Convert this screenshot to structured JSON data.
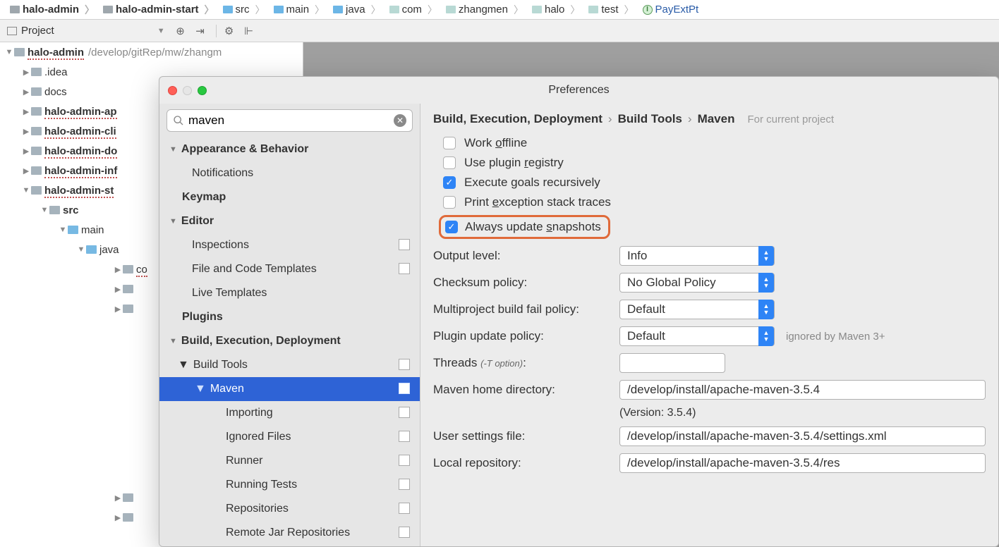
{
  "breadcrumb": [
    {
      "label": "halo-admin",
      "bold": true,
      "icon": "mod"
    },
    {
      "label": "halo-admin-start",
      "bold": true,
      "icon": "mod"
    },
    {
      "label": "src",
      "icon": "blue"
    },
    {
      "label": "main",
      "icon": "blue"
    },
    {
      "label": "java",
      "icon": "blue"
    },
    {
      "label": "com",
      "icon": "teal"
    },
    {
      "label": "zhangmen",
      "icon": "teal"
    },
    {
      "label": "halo",
      "icon": "teal"
    },
    {
      "label": "test",
      "icon": "teal"
    },
    {
      "label": "PayExtPt",
      "icon": "iface"
    }
  ],
  "project_label": "Project",
  "tree": {
    "root": {
      "name": "halo-admin",
      "path": "/develop/gitRep/mw/zhangm"
    },
    "children": [
      {
        "name": ".idea",
        "indent": 1,
        "arrow": "right",
        "bold": false
      },
      {
        "name": "docs",
        "indent": 1,
        "arrow": "right",
        "bold": false
      },
      {
        "name": "halo-admin-ap",
        "indent": 1,
        "arrow": "right",
        "bold": true,
        "squiggly": true
      },
      {
        "name": "halo-admin-cli",
        "indent": 1,
        "arrow": "right",
        "bold": true,
        "squiggly": true
      },
      {
        "name": "halo-admin-do",
        "indent": 1,
        "arrow": "right",
        "bold": true,
        "squiggly": true
      },
      {
        "name": "halo-admin-inf",
        "indent": 1,
        "arrow": "right",
        "bold": true,
        "squiggly": true
      },
      {
        "name": "halo-admin-st",
        "indent": 1,
        "arrow": "down",
        "bold": true,
        "squiggly": true
      },
      {
        "name": "src",
        "indent": 2,
        "arrow": "down",
        "bold": true,
        "blue": false
      },
      {
        "name": "main",
        "indent": 3,
        "arrow": "down",
        "bold": false,
        "blue": true
      },
      {
        "name": "java",
        "indent": 4,
        "arrow": "down",
        "bold": false,
        "blue": true
      },
      {
        "name": "co",
        "indent": 5,
        "arrow": "right",
        "bold": false,
        "blue": false,
        "squiggly": true
      },
      {
        "name": "",
        "indent": 5,
        "arrow": "right",
        "bold": false,
        "blank": true
      },
      {
        "name": "",
        "indent": 5,
        "arrow": "right",
        "bold": false,
        "blank": true
      }
    ],
    "footer": [
      {
        "name": "",
        "indent": 3,
        "arrow": "right",
        "blank": true
      },
      {
        "name": "",
        "indent": 3,
        "arrow": "right",
        "blank": true
      }
    ]
  },
  "modal": {
    "title": "Preferences",
    "search": "maven",
    "categories": [
      {
        "type": "cat",
        "label": "Appearance & Behavior",
        "tri": "down"
      },
      {
        "type": "sub",
        "label": "Notifications"
      },
      {
        "type": "cat",
        "label": "Keymap",
        "tri": "none"
      },
      {
        "type": "cat",
        "label": "Editor",
        "tri": "down"
      },
      {
        "type": "sub",
        "label": "Inspections",
        "copy": true
      },
      {
        "type": "sub",
        "label": "File and Code Templates",
        "copy": true
      },
      {
        "type": "sub",
        "label": "Live Templates"
      },
      {
        "type": "cat",
        "label": "Plugins",
        "tri": "none"
      },
      {
        "type": "cat",
        "label": "Build, Execution, Deployment",
        "tri": "down"
      },
      {
        "type": "sub",
        "label": "Build Tools",
        "copy": true,
        "tri": "down"
      },
      {
        "type": "sub2",
        "label": "Maven",
        "copy": true,
        "tri": "down",
        "selected": true
      },
      {
        "type": "sub3",
        "label": "Importing",
        "copy": true
      },
      {
        "type": "sub3",
        "label": "Ignored Files",
        "copy": true
      },
      {
        "type": "sub3",
        "label": "Runner",
        "copy": true
      },
      {
        "type": "sub3",
        "label": "Running Tests",
        "copy": true
      },
      {
        "type": "sub3",
        "label": "Repositories",
        "copy": true
      },
      {
        "type": "sub3",
        "label": "Remote Jar Repositories",
        "copy": true
      }
    ],
    "crumb": [
      "Build, Execution, Deployment",
      "Build Tools",
      "Maven"
    ],
    "crumb_hint": "For current project",
    "checks": [
      {
        "key": "work_offline",
        "pre": "Work ",
        "u": "o",
        "post": "ffline",
        "checked": false
      },
      {
        "key": "plugin_reg",
        "pre": "Use plugin ",
        "u": "r",
        "post": "egistry",
        "checked": false
      },
      {
        "key": "exec_goals",
        "pre": "Execute goals recursively",
        "u": "",
        "post": "",
        "checked": true
      },
      {
        "key": "print_exc",
        "pre": "Print ",
        "u": "e",
        "post": "xception stack traces",
        "checked": false
      },
      {
        "key": "always_snap",
        "pre": "Always update ",
        "u": "s",
        "post": "napshots",
        "checked": true,
        "highlight": true
      }
    ],
    "form": {
      "output_level": {
        "label": "Output level:",
        "value": "Info"
      },
      "checksum": {
        "label": "Checksum policy:",
        "value": "No Global Policy"
      },
      "multiproject": {
        "label": "Multiproject build fail policy:",
        "value": "Default"
      },
      "plugin_update": {
        "label": "Plugin update policy:",
        "value": "Default",
        "note": "ignored by Maven 3+"
      },
      "threads": {
        "label": "Threads",
        "sub": "(-T option)",
        "value": ""
      },
      "maven_home": {
        "label": "Maven home directory:",
        "value": "/develop/install/apache-maven-3.5.4"
      },
      "version": "(Version: 3.5.4)",
      "user_settings": {
        "label": "User settings file:",
        "value": "/develop/install/apache-maven-3.5.4/settings.xml"
      },
      "local_repo": {
        "label": "Local repository:",
        "value": "/develop/install/apache-maven-3.5.4/res"
      }
    }
  }
}
